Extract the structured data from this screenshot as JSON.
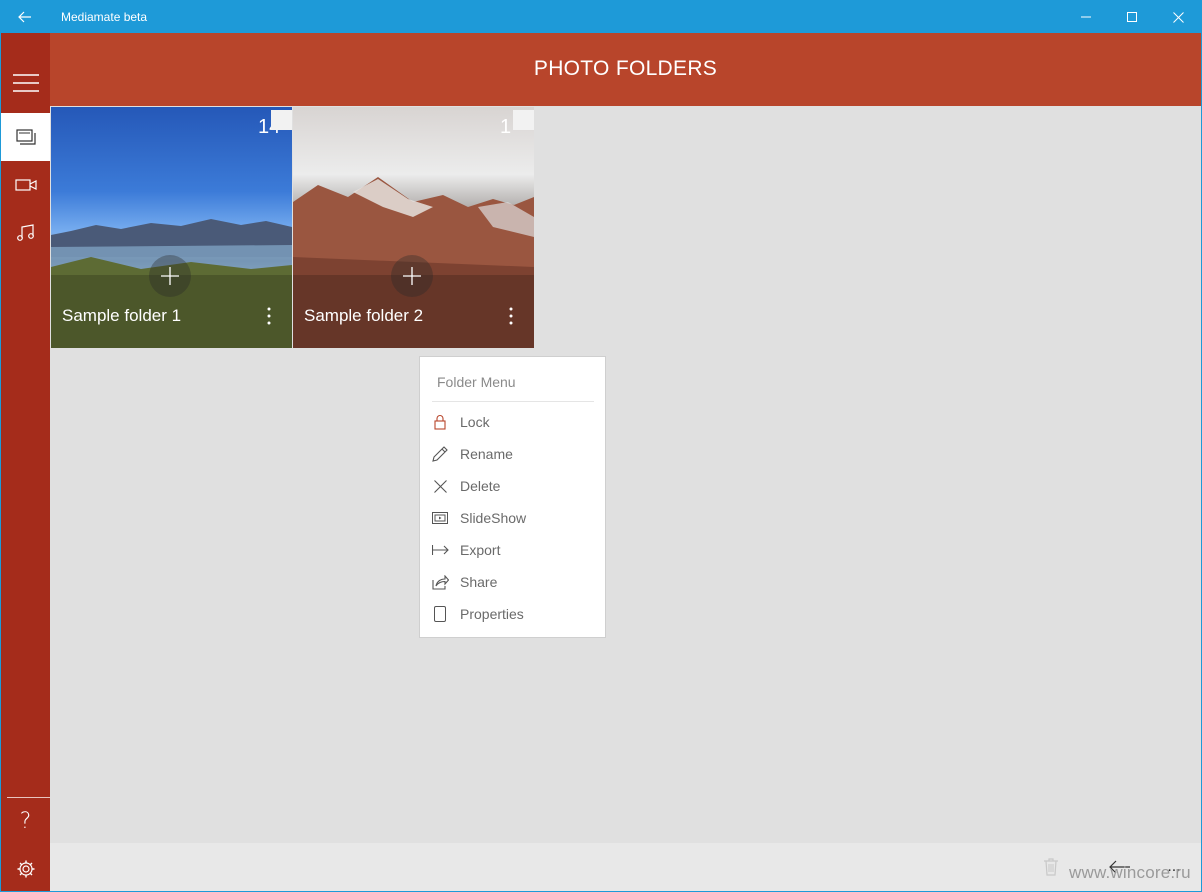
{
  "window": {
    "title": "Mediamate beta"
  },
  "header": {
    "title": "PHOTO FOLDERS"
  },
  "sidebar": {
    "items": [
      {
        "name": "menu",
        "icon": "hamburger-icon"
      },
      {
        "name": "photos",
        "icon": "photo-stack-icon",
        "selected": true
      },
      {
        "name": "videos",
        "icon": "video-camera-icon"
      },
      {
        "name": "music",
        "icon": "music-note-icon"
      }
    ],
    "bottom": [
      {
        "name": "help",
        "label": "?"
      },
      {
        "name": "settings",
        "icon": "gear-icon"
      }
    ]
  },
  "folders": [
    {
      "name": "Sample folder 1",
      "count": "14"
    },
    {
      "name": "Sample folder 2",
      "count": "1"
    }
  ],
  "menu": {
    "title": "Folder Menu",
    "items": [
      {
        "label": "Lock",
        "icon": "lock-icon"
      },
      {
        "label": "Rename",
        "icon": "pencil-icon"
      },
      {
        "label": "Delete",
        "icon": "close-icon"
      },
      {
        "label": "SlideShow",
        "icon": "slideshow-icon"
      },
      {
        "label": "Export",
        "icon": "export-icon"
      },
      {
        "label": "Share",
        "icon": "share-icon"
      },
      {
        "label": "Properties",
        "icon": "properties-icon"
      }
    ]
  },
  "appbar": {
    "more": "...",
    "watermark": "www.wincore.ru"
  },
  "colors": {
    "titlebar": "#1e9ad8",
    "sidebar": "#a52c1b",
    "header": "#b8452b",
    "content": "#e0e0e0",
    "lock_accent": "#b8452b"
  }
}
